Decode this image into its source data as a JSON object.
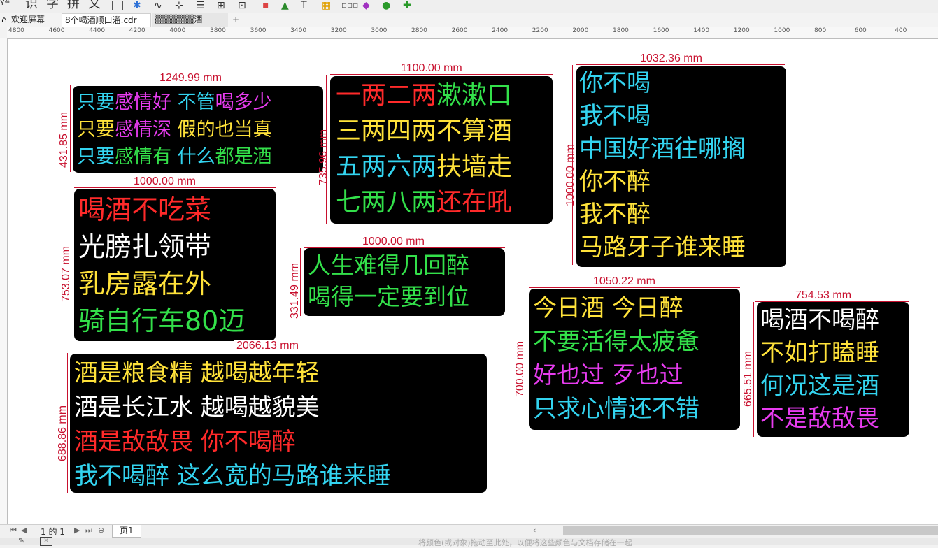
{
  "toolbar": {
    "chars": [
      "识",
      "字",
      "拼",
      "文"
    ]
  },
  "tabs": {
    "welcome": "欢迎屏幕",
    "file1": "8个喝酒顺口溜.cdr",
    "file2": "▒▒▒▒▒▒酒词.cdr",
    "add": "+"
  },
  "ruler": {
    "ticks": [
      "4800",
      "4600",
      "4400",
      "4200",
      "4000",
      "3800",
      "3600",
      "3400",
      "3200",
      "3000",
      "2800",
      "2600",
      "2400",
      "2200",
      "2000",
      "1800",
      "1600",
      "1400",
      "1200",
      "1000",
      "800",
      "600",
      "400"
    ]
  },
  "boards": {
    "b1": {
      "width": "1249.99 mm",
      "height": "431.85 mm",
      "lines": [
        [
          {
            "t": "只要",
            "c": "cyan"
          },
          {
            "t": "感情好",
            "c": "mag"
          },
          {
            "t": "  不管",
            "c": "cyan"
          },
          {
            "t": "喝多少",
            "c": "mag"
          }
        ],
        [
          {
            "t": "只要",
            "c": "yel"
          },
          {
            "t": "感情深",
            "c": "mag"
          },
          {
            "t": "  假的也当真",
            "c": "yel"
          }
        ],
        [
          {
            "t": "只要",
            "c": "cyan"
          },
          {
            "t": "感情有",
            "c": "grn"
          },
          {
            "t": "  什么",
            "c": "cyan"
          },
          {
            "t": "都是酒",
            "c": "grn"
          }
        ]
      ]
    },
    "b2": {
      "width": "1100.00 mm",
      "height": "735.96 mm",
      "lines": [
        [
          {
            "t": "一两二两",
            "c": "red"
          },
          {
            "t": "漱漱口",
            "c": "grn"
          }
        ],
        [
          {
            "t": "三两四两",
            "c": "yel"
          },
          {
            "t": "不算酒",
            "c": "yel"
          }
        ],
        [
          {
            "t": "五两六两",
            "c": "cyan"
          },
          {
            "t": "扶墙走",
            "c": "yel"
          }
        ],
        [
          {
            "t": "七两八两",
            "c": "grn"
          },
          {
            "t": "还在吼",
            "c": "red"
          }
        ]
      ]
    },
    "b3": {
      "width": "1032.36 mm",
      "height": "1000.00 mm",
      "lines": [
        [
          {
            "t": "你不喝",
            "c": "cyan"
          }
        ],
        [
          {
            "t": "我不喝",
            "c": "cyan"
          }
        ],
        [
          {
            "t": "中国好酒往哪搁",
            "c": "cyan"
          }
        ],
        [
          {
            "t": "你不醉",
            "c": "yel"
          }
        ],
        [
          {
            "t": "我不醉",
            "c": "yel"
          }
        ],
        [
          {
            "t": "马路牙子谁来睡",
            "c": "yel"
          }
        ]
      ]
    },
    "b4": {
      "width": "1000.00 mm",
      "height": "753.07 mm",
      "lines": [
        [
          {
            "t": "喝酒不吃菜",
            "c": "red"
          }
        ],
        [
          {
            "t": "光膀扎领带",
            "c": "wht"
          }
        ],
        [
          {
            "t": "乳房露在外",
            "c": "yel"
          }
        ],
        [
          {
            "t": "骑自行车80迈",
            "c": "grn"
          }
        ]
      ]
    },
    "b5": {
      "width": "1000.00 mm",
      "height": "331.49 mm",
      "lines": [
        [
          {
            "t": "人生难得几回醉",
            "c": "grn"
          }
        ],
        [
          {
            "t": "喝得一定要到位",
            "c": "grn"
          }
        ]
      ]
    },
    "b6": {
      "width": "1050.22 mm",
      "height": "700.00 mm",
      "lines": [
        [
          {
            "t": "今日酒   今日醉",
            "c": "yel"
          }
        ],
        [
          {
            "t": "不要活得太疲惫",
            "c": "grn"
          }
        ],
        [
          {
            "t": "好也过   ",
            "c": "mag"
          },
          {
            "t": "歹也过",
            "c": "mag"
          }
        ],
        [
          {
            "t": "只求心情还不错",
            "c": "cyan"
          }
        ]
      ]
    },
    "b7": {
      "width": "754.53 mm",
      "height": "665.51 mm",
      "lines": [
        [
          {
            "t": "喝酒不喝醉",
            "c": "wht"
          }
        ],
        [
          {
            "t": "不如打瞌睡",
            "c": "yel"
          }
        ],
        [
          {
            "t": "何况这是酒",
            "c": "cyan"
          }
        ],
        [
          {
            "t": "不是敌敌畏",
            "c": "mag"
          }
        ]
      ]
    },
    "b8": {
      "width": "2066.13 mm",
      "height": "688.86 mm",
      "lines": [
        [
          {
            "t": "酒是粮食精   ",
            "c": "yel"
          },
          {
            "t": "越喝越年轻",
            "c": "yel"
          }
        ],
        [
          {
            "t": "酒是长江水   ",
            "c": "wht"
          },
          {
            "t": "越喝越貌美",
            "c": "wht"
          }
        ],
        [
          {
            "t": "酒是敌敌畏   ",
            "c": "red"
          },
          {
            "t": "你不喝醉",
            "c": "red"
          }
        ],
        [
          {
            "t": "我不喝醉  ",
            "c": "cyan"
          },
          {
            "t": "这么宽的马路谁来睡",
            "c": "cyan"
          }
        ]
      ]
    }
  },
  "status": {
    "page_info": "1 的 1",
    "page_tab": "页1",
    "hint": "将颜色(或对象)拖动至此处，以便将这些颜色与文档存储在一起"
  }
}
